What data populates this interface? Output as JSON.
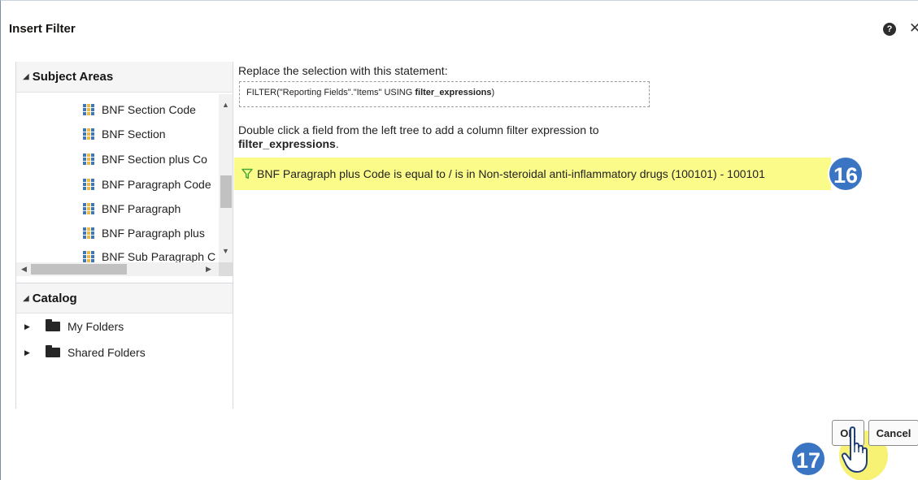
{
  "dialog": {
    "title": "Insert Filter",
    "help_icon": "help-icon",
    "close_icon": "close-icon",
    "help_glyph": "?",
    "close_glyph": "✕"
  },
  "subject_areas": {
    "header": "Subject Areas",
    "items": [
      "BNF Section Code",
      "BNF Section",
      "BNF Section plus Co",
      "BNF Paragraph Code",
      "BNF Paragraph",
      "BNF Paragraph plus",
      "BNF Sub Paragraph C"
    ]
  },
  "catalog": {
    "header": "Catalog",
    "items": [
      "My Folders",
      "Shared Folders"
    ]
  },
  "main": {
    "replace_label": "Replace the selection with this statement:",
    "statement_prefix": "FILTER(\"Reporting Fields\".\"Items\" USING ",
    "statement_bold": "filter_expressions",
    "statement_suffix": ")",
    "instruction_line1": "Double click a field from the left tree to add a column filter expression to",
    "instruction_bold": "filter_expressions",
    "instruction_end": ".",
    "filter_expression": "BNF Paragraph plus Code is equal to / is in  Non-steroidal anti-inflammatory drugs (100101) - 100101"
  },
  "buttons": {
    "ok": "OK",
    "cancel": "Cancel"
  },
  "annotations": {
    "step_16": "16",
    "step_17": "17"
  },
  "colors": {
    "highlight": "#fbfb8a",
    "badge": "#3a75c4",
    "column_icon_blue": "#3f79b5",
    "column_icon_gold": "#f0b93a",
    "funnel": "#4aa63c"
  }
}
